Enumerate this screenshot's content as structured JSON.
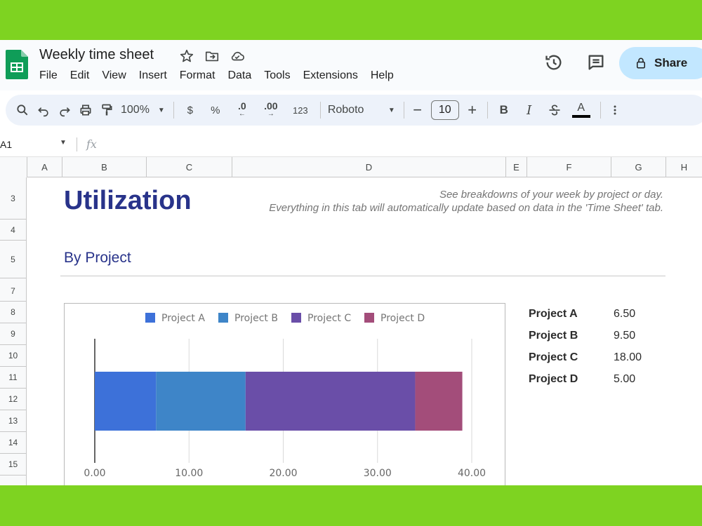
{
  "app": {
    "doc_title": "Weekly time sheet",
    "menu": [
      "File",
      "Edit",
      "View",
      "Insert",
      "Format",
      "Data",
      "Tools",
      "Extensions",
      "Help"
    ],
    "share_label": "Share"
  },
  "toolbar": {
    "zoom": "100%",
    "currency": "$",
    "percent": "%",
    "dec_decrease": ".0",
    "dec_increase": ".00",
    "number_format": "123",
    "font": "Roboto",
    "font_size": "10",
    "bold": "B",
    "italic": "I",
    "text_color": "A"
  },
  "formula_bar": {
    "cell_ref": "A1",
    "fx": "fx"
  },
  "columns": [
    "A",
    "B",
    "C",
    "D",
    "E",
    "F",
    "G",
    "H"
  ],
  "rows": [
    "3",
    "4",
    "5",
    "7",
    "8",
    "9",
    "10",
    "11",
    "12",
    "13",
    "14",
    "15"
  ],
  "sheet": {
    "title": "Utilization",
    "description_line1": "See breakdowns of your week by project or day.",
    "description_line2": "Everything in this tab will automatically update based on data in the 'Time Sheet' tab.",
    "section_title": "By Project"
  },
  "summary": [
    {
      "label": "Project A",
      "value": "6.50"
    },
    {
      "label": "Project B",
      "value": "9.50"
    },
    {
      "label": "Project C",
      "value": "18.00"
    },
    {
      "label": "Project D",
      "value": "5.00"
    }
  ],
  "chart_data": {
    "type": "bar",
    "orientation": "horizontal",
    "stacked": true,
    "categories": [
      ""
    ],
    "series": [
      {
        "name": "Project A",
        "values": [
          6.5
        ],
        "color": "#3d71d9"
      },
      {
        "name": "Project B",
        "values": [
          9.5
        ],
        "color": "#3e85c8"
      },
      {
        "name": "Project C",
        "values": [
          18.0
        ],
        "color": "#6a4ea8"
      },
      {
        "name": "Project D",
        "values": [
          5.0
        ],
        "color": "#a34d7a"
      }
    ],
    "xlim": [
      0,
      40
    ],
    "xticks": [
      "0.00",
      "10.00",
      "20.00",
      "30.00",
      "40.00"
    ],
    "grid": true,
    "legend": "top"
  }
}
